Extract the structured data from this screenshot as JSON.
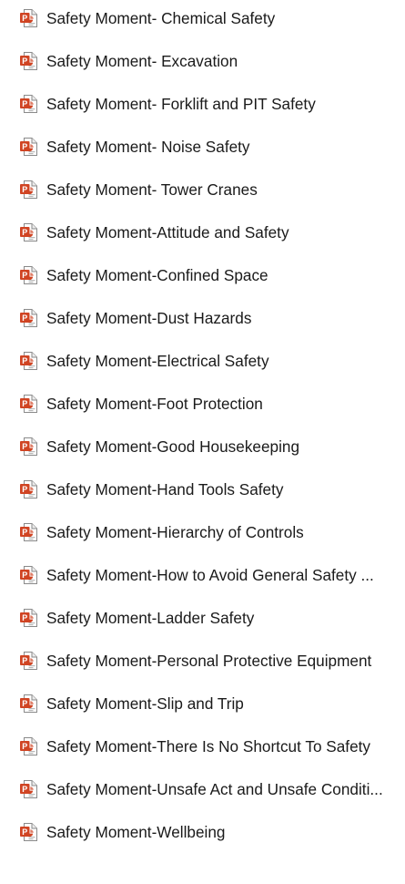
{
  "icons": {
    "file_icon": "powerpoint-file-icon",
    "brand_color": "#D04423"
  },
  "files": [
    {
      "name": "Safety Moment- Chemical Safety"
    },
    {
      "name": "Safety Moment- Excavation"
    },
    {
      "name": "Safety Moment- Forklift and PIT Safety"
    },
    {
      "name": "Safety Moment- Noise Safety"
    },
    {
      "name": "Safety Moment- Tower Cranes"
    },
    {
      "name": "Safety Moment-Attitude and Safety"
    },
    {
      "name": "Safety Moment-Confined Space"
    },
    {
      "name": "Safety Moment-Dust Hazards"
    },
    {
      "name": "Safety Moment-Electrical Safety"
    },
    {
      "name": "Safety Moment-Foot Protection"
    },
    {
      "name": "Safety Moment-Good Housekeeping"
    },
    {
      "name": "Safety Moment-Hand Tools Safety"
    },
    {
      "name": "Safety Moment-Hierarchy of Controls"
    },
    {
      "name": "Safety Moment-How to Avoid General Safety ..."
    },
    {
      "name": "Safety Moment-Ladder Safety"
    },
    {
      "name": "Safety Moment-Personal Protective Equipment"
    },
    {
      "name": "Safety Moment-Slip and Trip"
    },
    {
      "name": "Safety Moment-There Is No Shortcut To Safety"
    },
    {
      "name": "Safety Moment-Unsafe Act and Unsafe Conditi..."
    },
    {
      "name": "Safety Moment-Wellbeing"
    }
  ]
}
